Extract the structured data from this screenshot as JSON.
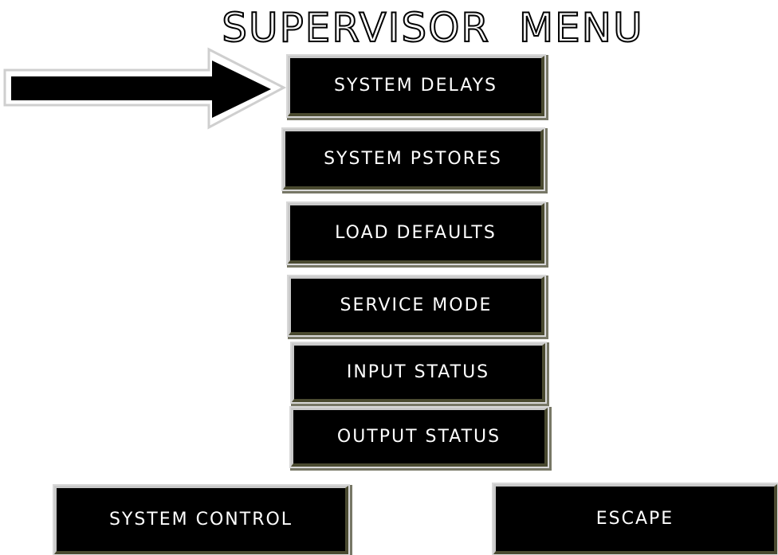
{
  "screen": {
    "title": "SUPERVISOR  MENU"
  },
  "menu": {
    "buttons": [
      {
        "id": "system-delays",
        "label": "SYSTEM DELAYS"
      },
      {
        "id": "system-pstores",
        "label": "SYSTEM PSTORES"
      },
      {
        "id": "load-defaults",
        "label": "LOAD DEFAULTS"
      },
      {
        "id": "service-mode",
        "label": "SERVICE MODE"
      },
      {
        "id": "input-status",
        "label": "INPUT STATUS"
      },
      {
        "id": "output-status",
        "label": "OUTPUT STATUS"
      }
    ]
  },
  "footer": {
    "system_control_label": "SYSTEM CONTROL",
    "escape_label": "ESCAPE"
  },
  "indicator": {
    "icon": "right-arrow-icon",
    "points_to": "SYSTEM DELAYS"
  },
  "colors": {
    "background": "#ffffff",
    "button_bg": "#000000",
    "button_text": "#ffffff"
  }
}
